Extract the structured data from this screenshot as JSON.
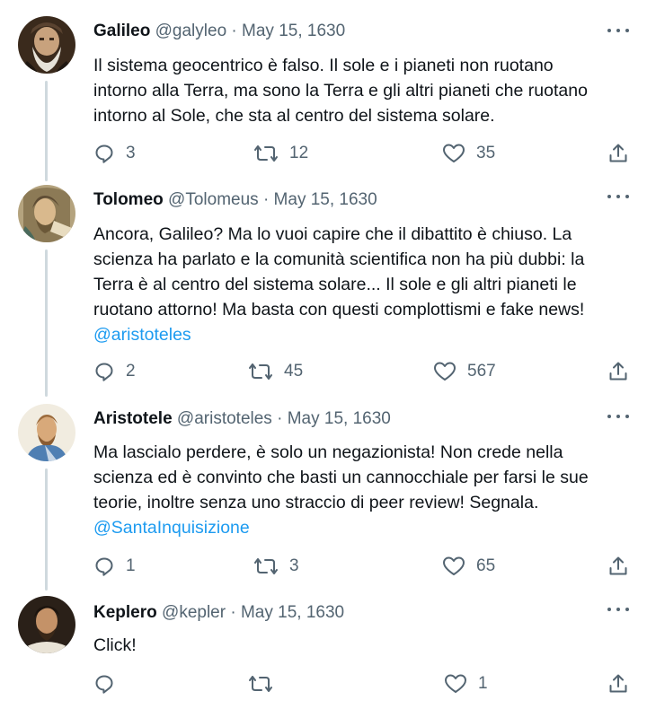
{
  "tweets": [
    {
      "name": "Galileo",
      "handle": "@galyleo",
      "separator": "·",
      "date": "May 15, 1630",
      "text_lines": [
        "Il sistema geocentrico è falso. Il sole e i pianeti non ruotano",
        "intorno alla Terra, ma sono la Terra e gli altri pianeti che ruotano",
        "intorno al Sole, che sta al centro del sistema solare."
      ],
      "mention": "",
      "replies": "3",
      "retweets": "12",
      "likes": "35"
    },
    {
      "name": "Tolomeo",
      "handle": "@Tolomeus",
      "separator": "·",
      "date": "May 15, 1630",
      "text_lines": [
        "Ancora, Galileo? Ma lo vuoi capire che il dibattito è chiuso. La",
        "scienza ha parlato e la comunità scientifica non ha più dubbi: la",
        "Terra è al centro del sistema solare... Il sole e gli altri pianeti le",
        "ruotano attorno! Ma basta con questi complottismi e fake news!"
      ],
      "mention": "@aristoteles",
      "replies": "2",
      "retweets": "45",
      "likes": "567"
    },
    {
      "name": "Aristotele",
      "handle": "@aristoteles",
      "separator": "·",
      "date": "May 15, 1630",
      "text_lines": [
        "Ma lascialo perdere, è solo un negazionista! Non crede nella",
        "scienza ed è convinto che basti un cannocchiale per farsi le sue",
        "teorie, inoltre senza uno straccio di peer review! Segnala."
      ],
      "mention": "@SantaInquisizione",
      "replies": "1",
      "retweets": "3",
      "likes": "65"
    },
    {
      "name": "Keplero",
      "handle": "@kepler",
      "separator": "·",
      "date": "May 15, 1630",
      "text_lines": [
        "Click!"
      ],
      "mention": "",
      "replies": "",
      "retweets": "",
      "likes": "1"
    }
  ],
  "icons": {
    "reply": "reply-icon",
    "retweet": "retweet-icon",
    "like": "heart-icon",
    "share": "share-icon",
    "more": "more-options-icon"
  },
  "colors": {
    "text": "#0f1419",
    "secondary": "#536471",
    "link": "#1d9bf0",
    "thread_line": "#cfd9de"
  }
}
